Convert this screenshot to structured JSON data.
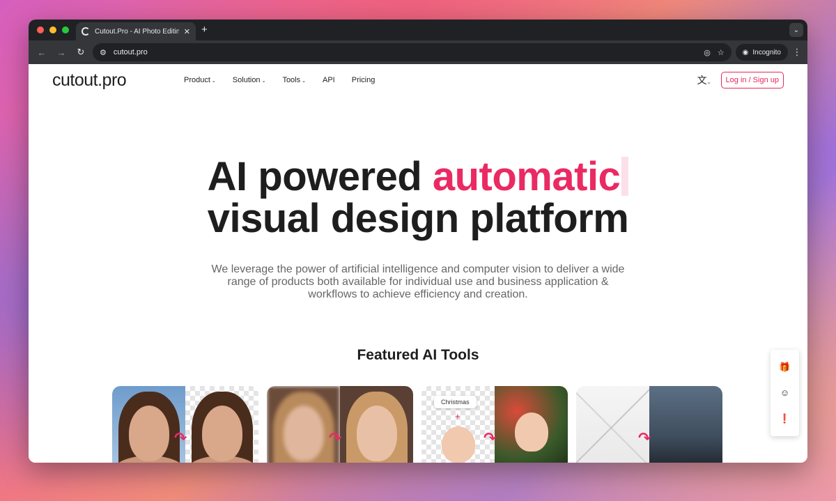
{
  "browser": {
    "tab_title": "Cutout.Pro - AI Photo Editing",
    "tab_close": "✕",
    "new_tab": "+",
    "url": "cutout.pro",
    "incognito_label": "Incognito"
  },
  "site": {
    "logo": "cutout.pro",
    "nav": [
      {
        "label": "Product",
        "has_dropdown": true
      },
      {
        "label": "Solution",
        "has_dropdown": true
      },
      {
        "label": "Tools",
        "has_dropdown": true
      },
      {
        "label": "API",
        "has_dropdown": false
      },
      {
        "label": "Pricing",
        "has_dropdown": false
      }
    ],
    "login_label": "Log in / Sign up"
  },
  "hero": {
    "title_part1": "AI powered ",
    "title_accent": "automatic",
    "title_line2": "visual design platform",
    "subtitle": "We leverage the power of artificial intelligence and computer vision to deliver a wide range of products both available for individual use and business application & workflows to achieve efficiency and creation."
  },
  "featured": {
    "heading": "Featured AI Tools",
    "cards": [
      {
        "name": "background-remover"
      },
      {
        "name": "photo-enhancer"
      },
      {
        "name": "christmas-background",
        "label": "Christmas"
      },
      {
        "name": "ai-interior-design"
      }
    ]
  },
  "colors": {
    "accent": "#ea2a63",
    "text": "#1e1e1e",
    "browser_dark": "#202124"
  }
}
